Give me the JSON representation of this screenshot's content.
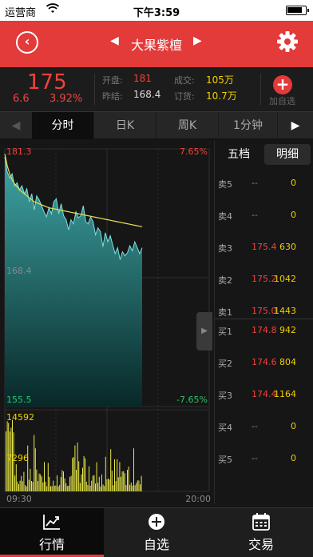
{
  "status_bar": {
    "carrier": "运营商",
    "time": "下午3:59"
  },
  "header": {
    "title": "大果紫檀",
    "back_icon": "back-circle-icon",
    "settings_icon": "gear-icon"
  },
  "quote": {
    "price": "175",
    "change": "6.6",
    "change_pct": "3.92%",
    "open_label": "开盘:",
    "open": "181",
    "prev_label": "昨结:",
    "prev": "168.4",
    "vol_label": "成交:",
    "vol": "105万",
    "order_label": "订货:",
    "order": "10.7万",
    "add_label": "加自选"
  },
  "tabs": [
    "分时",
    "日K",
    "周K",
    "1分钟"
  ],
  "chart_data": {
    "type": "line",
    "y_top_label": "181.3",
    "y_mid_label": "168.4",
    "y_bot_label": "155.5",
    "pct_top": "7.65%",
    "pct_bot": "-7.65%",
    "vol_top": "14592",
    "vol_mid": "7296",
    "x_start": "09:30",
    "x_end": "20:00",
    "ylim": [
      155.5,
      181.3
    ],
    "price_series": [
      180.5,
      179.0,
      178.4,
      178.8,
      177.6,
      177.9,
      177.2,
      177.6,
      176.8,
      177.3,
      176.0,
      176.8,
      175.2,
      176.6,
      176.2,
      175.6,
      175.0,
      174.5,
      175.4,
      174.8,
      176.0,
      176.3,
      174.8,
      175.8,
      174.6,
      174.2,
      173.2,
      174.2,
      173.8,
      175.0,
      174.4,
      174.6,
      175.6,
      174.0,
      173.8,
      174.5,
      174.0,
      172.7,
      173.4,
      173.0,
      171.5,
      172.9,
      172.0,
      172.6,
      171.7,
      170.8,
      171.4,
      170.2,
      171.0,
      170.6,
      170.9,
      171.6,
      171.1,
      172.0,
      171.4,
      170.8,
      171.4
    ],
    "avg_series": [
      180.8,
      179.6,
      178.8,
      178.2,
      177.8,
      177.5,
      177.2,
      177.0,
      176.8,
      176.6,
      176.4,
      176.2,
      176.0,
      175.9,
      175.8,
      175.7,
      175.6,
      175.5,
      175.4,
      175.35,
      175.3,
      175.25,
      175.2,
      175.15,
      175.1,
      175.05,
      175.0,
      174.95,
      174.9,
      174.85,
      174.8,
      174.75,
      174.7,
      174.65,
      174.6,
      174.55,
      174.5,
      174.45,
      174.4,
      174.35,
      174.3,
      174.25,
      174.2,
      174.15,
      174.1,
      174.05,
      174.0,
      173.95,
      173.9,
      173.85,
      173.8,
      173.75,
      173.7,
      173.65,
      173.6,
      173.55,
      173.5
    ]
  },
  "order_book": {
    "tabs": [
      "五档",
      "明细"
    ],
    "sell": [
      {
        "label": "卖5",
        "price": "--",
        "vol": "0"
      },
      {
        "label": "卖4",
        "price": "--",
        "vol": "0"
      },
      {
        "label": "卖3",
        "price": "175.4",
        "vol": "630"
      },
      {
        "label": "卖2",
        "price": "175.2",
        "vol": "1042"
      },
      {
        "label": "卖1",
        "price": "175.0",
        "vol": "1443"
      }
    ],
    "buy": [
      {
        "label": "买1",
        "price": "174.8",
        "vol": "942"
      },
      {
        "label": "买2",
        "price": "174.6",
        "vol": "804"
      },
      {
        "label": "买3",
        "price": "174.4",
        "vol": "1164"
      },
      {
        "label": "买4",
        "price": "--",
        "vol": "0"
      },
      {
        "label": "买5",
        "price": "--",
        "vol": "0"
      }
    ]
  },
  "nav": [
    {
      "label": "行情",
      "icon": "chart-trend-icon"
    },
    {
      "label": "自选",
      "icon": "plus-circle-icon"
    },
    {
      "label": "交易",
      "icon": "calendar-icon"
    }
  ],
  "colors": {
    "accent": "#e33a3a",
    "up": "#f0433c",
    "down": "#2dc46a",
    "volume": "#e8e84a",
    "gold": "#f0d000"
  }
}
